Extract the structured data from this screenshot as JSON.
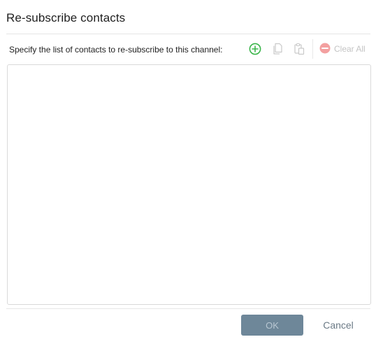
{
  "dialog": {
    "title": "Re-subscribe contacts",
    "instruction": "Specify the list of contacts to re-subscribe to this channel:"
  },
  "toolbar": {
    "add_icon": "plus-circle-icon",
    "copy_icon": "copy-icon",
    "paste_icon": "paste-icon",
    "clear_icon": "minus-circle-icon",
    "clear_label": "Clear All",
    "add_color": "#3ab54a",
    "disabled_color": "#c4c4c4",
    "clear_icon_color": "#f3a0a0"
  },
  "contacts_list": {
    "items": []
  },
  "footer": {
    "ok_label": "OK",
    "cancel_label": "Cancel",
    "ok_color": "#6e8799"
  }
}
